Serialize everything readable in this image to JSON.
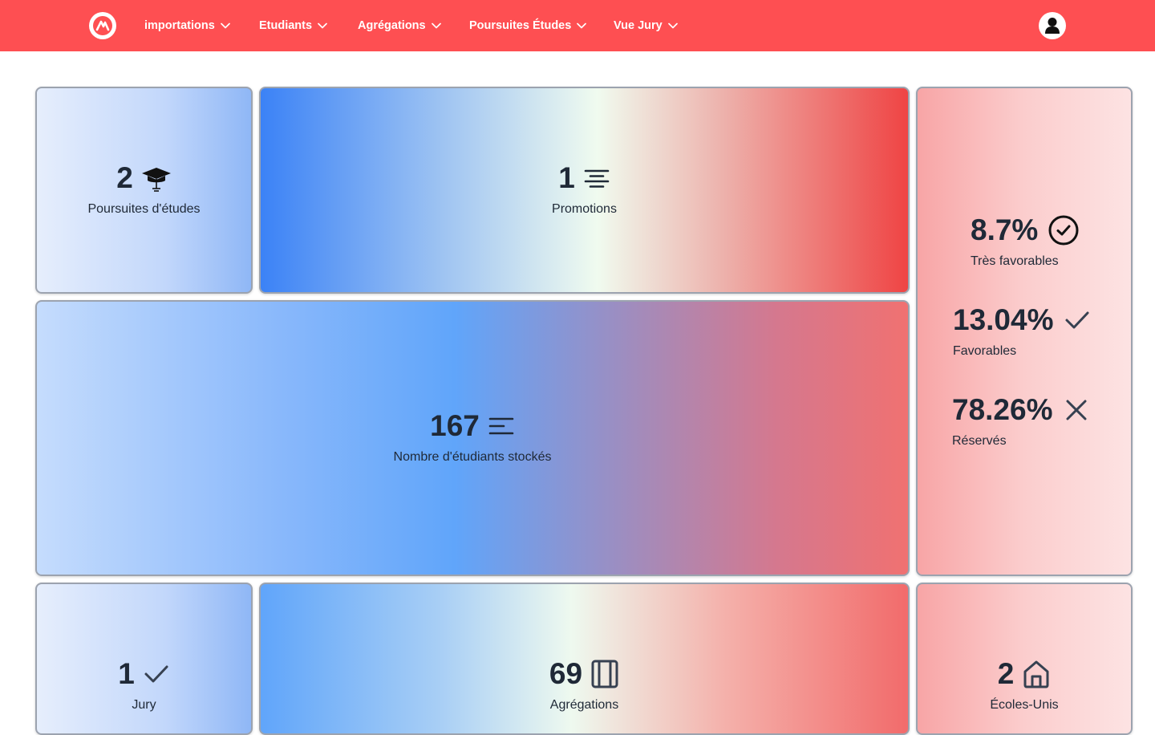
{
  "nav": {
    "logo_icon": "app-logo-icon",
    "items": [
      {
        "label": "importations"
      },
      {
        "label": "Etudiants"
      },
      {
        "label": "Agrégations"
      },
      {
        "label": "Poursuites Études"
      },
      {
        "label": "Vue Jury"
      }
    ],
    "avatar_icon": "user-icon"
  },
  "cards": {
    "poursuites": {
      "value": "2",
      "label": "Poursuites d'études",
      "icon": "graduation-cap-icon"
    },
    "promotions": {
      "value": "1",
      "label": "Promotions",
      "icon": "align-center-icon"
    },
    "etudiants": {
      "value": "167",
      "label": "Nombre d'étudiants stockés",
      "icon": "align-left-icon"
    },
    "jury": {
      "value": "1",
      "label": "Jury",
      "icon": "check-icon"
    },
    "agregations": {
      "value": "69",
      "label": "Agrégations",
      "icon": "book-icon"
    },
    "ecoles": {
      "value": "2",
      "label": "Écoles-Unis",
      "icon": "home-icon"
    }
  },
  "stats": {
    "tres_favorables": {
      "value": "8.7%",
      "label": "Très favorables",
      "icon": "check-circle-icon"
    },
    "favorables": {
      "value": "13.04%",
      "label": "Favorables",
      "icon": "check-icon"
    },
    "reserves": {
      "value": "78.26%",
      "label": "Réservés",
      "icon": "x-icon"
    }
  },
  "colors": {
    "navbar": "#fe4f52",
    "blue": "#3b82f6",
    "red": "#ef4444",
    "text": "#1f2937"
  }
}
